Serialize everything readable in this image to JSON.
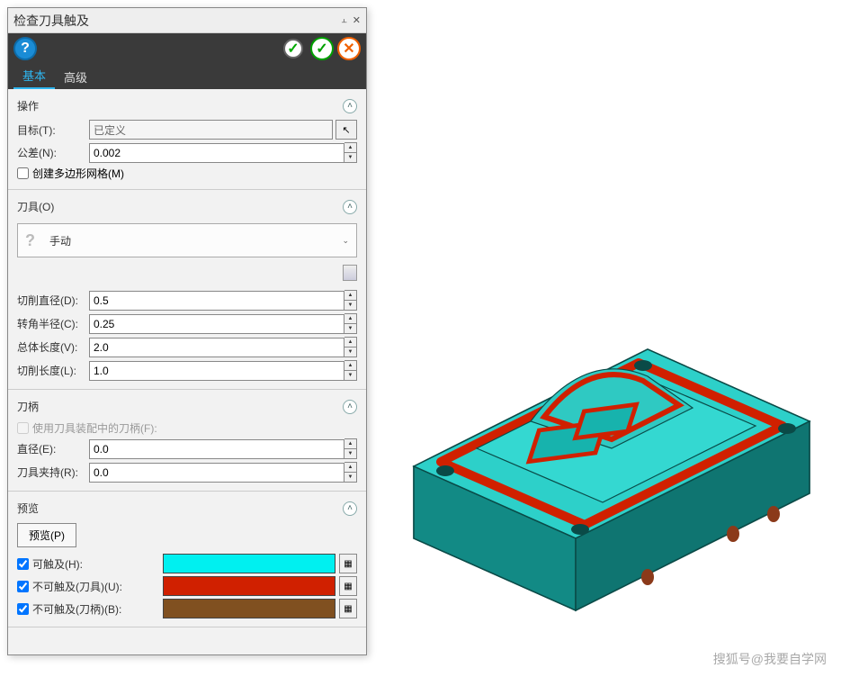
{
  "window": {
    "title": "检查刀具触及"
  },
  "tabs": {
    "basic": "基本",
    "advanced": "高级"
  },
  "sections": {
    "operation": {
      "title": "操作",
      "target_label": "目标(T):",
      "target_value": "已定义",
      "tolerance_label": "公差(N):",
      "tolerance_value": "0.002",
      "mesh_label": "创建多边形网格(M)"
    },
    "tool": {
      "title": "刀具(O)",
      "mode": "手动",
      "cut_diameter_label": "切削直径(D):",
      "cut_diameter_value": "0.5",
      "corner_radius_label": "转角半径(C):",
      "corner_radius_value": "0.25",
      "total_length_label": "总体长度(V):",
      "total_length_value": "2.0",
      "cut_length_label": "切削长度(L):",
      "cut_length_value": "1.0"
    },
    "holder": {
      "title": "刀柄",
      "use_holder_label": "使用刀具装配中的刀柄(F):",
      "diameter_label": "直径(E):",
      "diameter_value": "0.0",
      "clamp_label": "刀具夹持(R):",
      "clamp_value": "0.0"
    },
    "preview": {
      "title": "预览",
      "button": "预览(P)",
      "reachable_label": "可触及(H):",
      "unreachable_tool_label": "不可触及(刀具)(U):",
      "unreachable_holder_label": "不可触及(刀柄)(B):",
      "colors": {
        "reachable": "#00f0f0",
        "unreachable_tool": "#d02000",
        "unreachable_holder": "#805020"
      }
    }
  },
  "watermark": "搜狐号@我要自学网"
}
